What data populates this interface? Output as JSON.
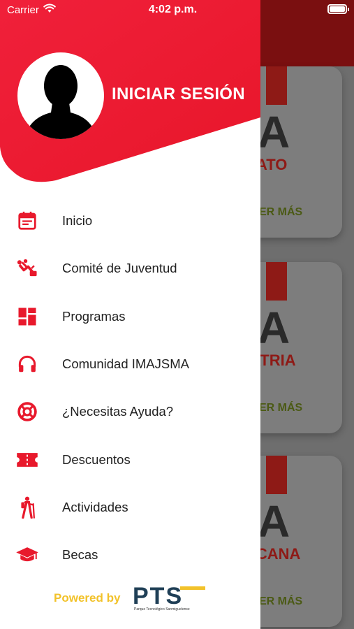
{
  "status_bar": {
    "carrier": "Carrier",
    "time": "4:02 p.m."
  },
  "drawer": {
    "header": {
      "login_label": "INICIAR SESIÓN"
    },
    "menu": [
      {
        "label": "Inicio",
        "icon": "calendar-icon"
      },
      {
        "label": "Comité de Juventud",
        "icon": "network-icon"
      },
      {
        "label": "Programas",
        "icon": "dashboard-icon"
      },
      {
        "label": "Comunidad IMAJSMA",
        "icon": "headphones-icon"
      },
      {
        "label": "¿Necesitas Ayuda?",
        "icon": "lifebuoy-icon"
      },
      {
        "label": "Descuentos",
        "icon": "ticket-icon"
      },
      {
        "label": "Actividades",
        "icon": "hiker-icon"
      },
      {
        "label": "Becas",
        "icon": "graduation-cap-icon"
      }
    ],
    "footer": {
      "powered_by": "Powered by",
      "logo_text": "PTS",
      "logo_subtitle": "Parque Tecnológico Sanmiguelense"
    }
  },
  "background_cards": [
    {
      "big": "A",
      "sub": "ATO",
      "more": "ER MÁS"
    },
    {
      "big": "A",
      "sub": "PATRIA",
      "more": "ER MÁS"
    },
    {
      "big": "A",
      "sub": "ACANA",
      "more": "ER MÁS"
    }
  ],
  "colors": {
    "accent": "#e8192c",
    "header_gradient_start": "#f0203a",
    "header_gradient_end": "#e8162a",
    "powered_by": "#f2c22a"
  }
}
